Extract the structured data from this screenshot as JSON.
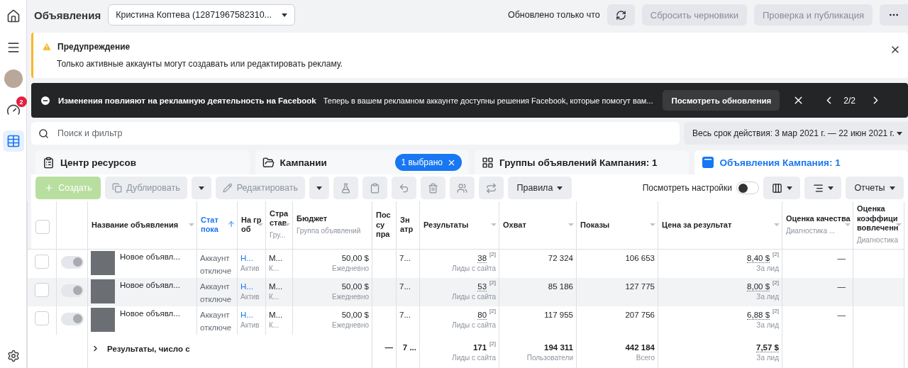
{
  "sidebar": {
    "items": [
      {
        "kind": "home",
        "selected": false
      },
      {
        "kind": "menu",
        "selected": false
      },
      {
        "kind": "avatar",
        "selected": false
      },
      {
        "kind": "gauge",
        "selected": false,
        "badge": "2"
      },
      {
        "kind": "table",
        "selected": true
      },
      {
        "kind": "settings",
        "selected": false
      }
    ]
  },
  "header": {
    "title": "Объявления",
    "account": "Кристина Коптева (12871967582310...",
    "updated": "Обновлено только что",
    "buttons": [
      {
        "label": "Сбросить черновики",
        "disabled": true
      },
      {
        "label": "Проверка и публикация",
        "disabled": true
      }
    ]
  },
  "warning": {
    "title": "Предупреждение",
    "text": "Только активные аккаунты могут создавать или редактировать рекламу."
  },
  "banner": {
    "title": "Изменения повлияют на рекламную деятельность на Facebook",
    "text": "Теперь в вашем рекламном аккаунте доступны решения Facebook, которые помогут вам...",
    "button": "Посмотреть обновления",
    "pager": "2/2"
  },
  "search": {
    "placeholder": "Поиск и фильтр"
  },
  "date_range": "Весь срок действия: 3 мар 2021 г. — 22 июн 2021 г.",
  "tabs": [
    {
      "kind": "resources",
      "label": "Центр ресурсов",
      "selected": false
    },
    {
      "kind": "campaigns",
      "label": "Кампании",
      "chip": "1 выбрано",
      "selected": false
    },
    {
      "kind": "adsets",
      "label": "Группы объявлений Кампания: 1",
      "selected": false
    },
    {
      "kind": "ads",
      "label": "Объявления Кампания: 1",
      "selected": true
    }
  ],
  "toolbar": {
    "create": {
      "label": "Создать",
      "disabled": true
    },
    "duplicate": {
      "label": "Дублировать",
      "disabled": true
    },
    "edit": {
      "label": "Редактировать",
      "disabled": true
    },
    "rules": "Правила",
    "view_settings": {
      "label": "Посмотреть настройки",
      "on": false
    },
    "reports": "Отчеты"
  },
  "table": {
    "all_selected": false,
    "columns": [
      {
        "kind": "ad",
        "label": "Название объявления",
        "sorted": false
      },
      {
        "kind": "status",
        "label": "Стат пока",
        "sorted": true
      },
      {
        "kind": "text",
        "label": "На гр об",
        "sorted": false
      },
      {
        "kind": "text",
        "label": "Стра став",
        "sublabel": "Гру...",
        "sorted": false
      },
      {
        "kind": "number",
        "label": "Бюджет",
        "sublabel": "Группа объявлений",
        "sorted": false
      },
      {
        "kind": "text",
        "label": "Пос су пра",
        "sorted": false
      },
      {
        "kind": "text",
        "label": "Зн атр",
        "sorted": false
      },
      {
        "kind": "number",
        "label": "Результаты",
        "sorted": false
      },
      {
        "kind": "number",
        "label": "Охват",
        "sorted": false
      },
      {
        "kind": "number",
        "label": "Показы",
        "sorted": false
      },
      {
        "kind": "number",
        "label": "Цена за результат",
        "sorted": false
      },
      {
        "kind": "dash",
        "label": "Оценка качества",
        "sublabel": "Диагностика ...",
        "sorted": false
      },
      {
        "kind": "text",
        "label": "Оценка коэффици вовлеченн",
        "sublabel": "Диагностика",
        "sorted": false
      }
    ],
    "rows": [
      {
        "selected": false,
        "on": true,
        "hovered": false,
        "cells": [
          {
            "text": "Новое объявл..."
          },
          {
            "text": "Аккаунт отключе"
          },
          {
            "text": "Н...",
            "sub": "Актив"
          },
          {
            "text": "М...",
            "sub": "К..."
          },
          {
            "text": "50,00 $",
            "sub": "Ежедневно"
          },
          {},
          {
            "text": "7..."
          },
          {
            "text": "38",
            "note": "[2]",
            "sub": "Лиды с сайта"
          },
          {
            "text": "72 324"
          },
          {
            "text": "106 653"
          },
          {
            "text": "8,40 $",
            "note": "[2]",
            "sub": "За лид"
          },
          {
            "text": "—"
          },
          {}
        ]
      },
      {
        "selected": false,
        "on": true,
        "hovered": true,
        "cells": [
          {
            "text": "Новое объявл..."
          },
          {
            "text": "Аккаунт отключе"
          },
          {
            "text": "Н...",
            "sub": "Актив"
          },
          {
            "text": "М...",
            "sub": "К..."
          },
          {
            "text": "50,00 $",
            "sub": "Ежедневно"
          },
          {},
          {
            "text": "7..."
          },
          {
            "text": "53",
            "note": "[2]",
            "sub": "Лиды с сайта"
          },
          {
            "text": "85 186"
          },
          {
            "text": "127 775"
          },
          {
            "text": "8,00 $",
            "note": "[2]",
            "sub": "За лид"
          },
          {
            "text": "—"
          },
          {}
        ]
      },
      {
        "selected": false,
        "on": true,
        "hovered": false,
        "cells": [
          {
            "text": "Новое объявл..."
          },
          {
            "text": "Аккаунт отключе"
          },
          {
            "text": "Н...",
            "sub": "Актив"
          },
          {
            "text": "М...",
            "sub": "К..."
          },
          {
            "text": "50,00 $",
            "sub": "Ежедневно"
          },
          {},
          {
            "text": "7..."
          },
          {
            "text": "80",
            "note": "[2]",
            "sub": "Лиды с сайта"
          },
          {
            "text": "117 955"
          },
          {
            "text": "207 756"
          },
          {
            "text": "6,88 $",
            "note": "[2]",
            "sub": "За лид"
          },
          {
            "text": "—"
          },
          {}
        ]
      }
    ],
    "totals": {
      "label": "Результаты, число с",
      "cells": [
        {
          "text": "—"
        },
        {
          "text": "7 ..."
        },
        {
          "text": "171",
          "note": "[2]",
          "sub": "Лиды с сайта"
        },
        {
          "text": "194 311",
          "sub": "Пользователи"
        },
        {
          "text": "442 184",
          "sub": "Всего"
        },
        {
          "text": "7,57 $",
          "sub": "За лид"
        },
        {},
        {}
      ]
    }
  }
}
